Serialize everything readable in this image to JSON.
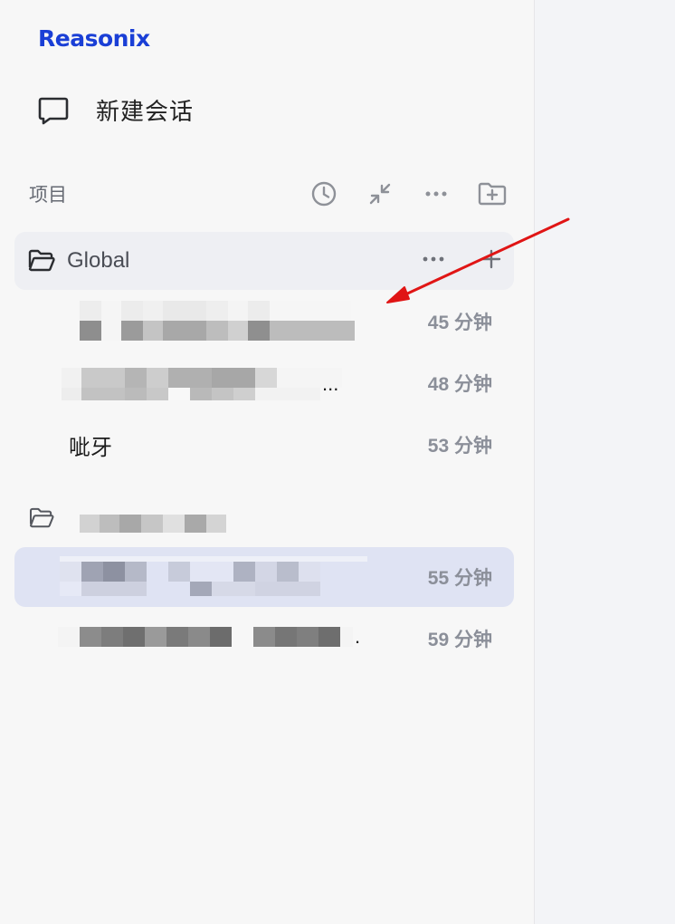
{
  "brand": {
    "name": "Reasonix",
    "color": "#1a3fd6"
  },
  "new_chat": {
    "label": "新建会话",
    "icon": "chat-bubble-icon"
  },
  "projects": {
    "title": "项目",
    "tools": [
      "clock-icon",
      "collapse-icon",
      "more-icon",
      "new-folder-icon"
    ]
  },
  "folders": [
    {
      "name": "Global",
      "items": [
        {
          "title": "",
          "time": "45 分钟"
        },
        {
          "title": "",
          "time": "48 分钟"
        },
        {
          "title": "呲牙",
          "time": "53 分钟"
        }
      ]
    },
    {
      "name": "",
      "items": [
        {
          "title": "",
          "time": "55 分钟",
          "selected": true
        },
        {
          "title": "",
          "time": "59 分钟"
        }
      ]
    }
  ],
  "colors": {
    "annotation_arrow": "#e01515",
    "selected_row": "#dfe3f3"
  }
}
